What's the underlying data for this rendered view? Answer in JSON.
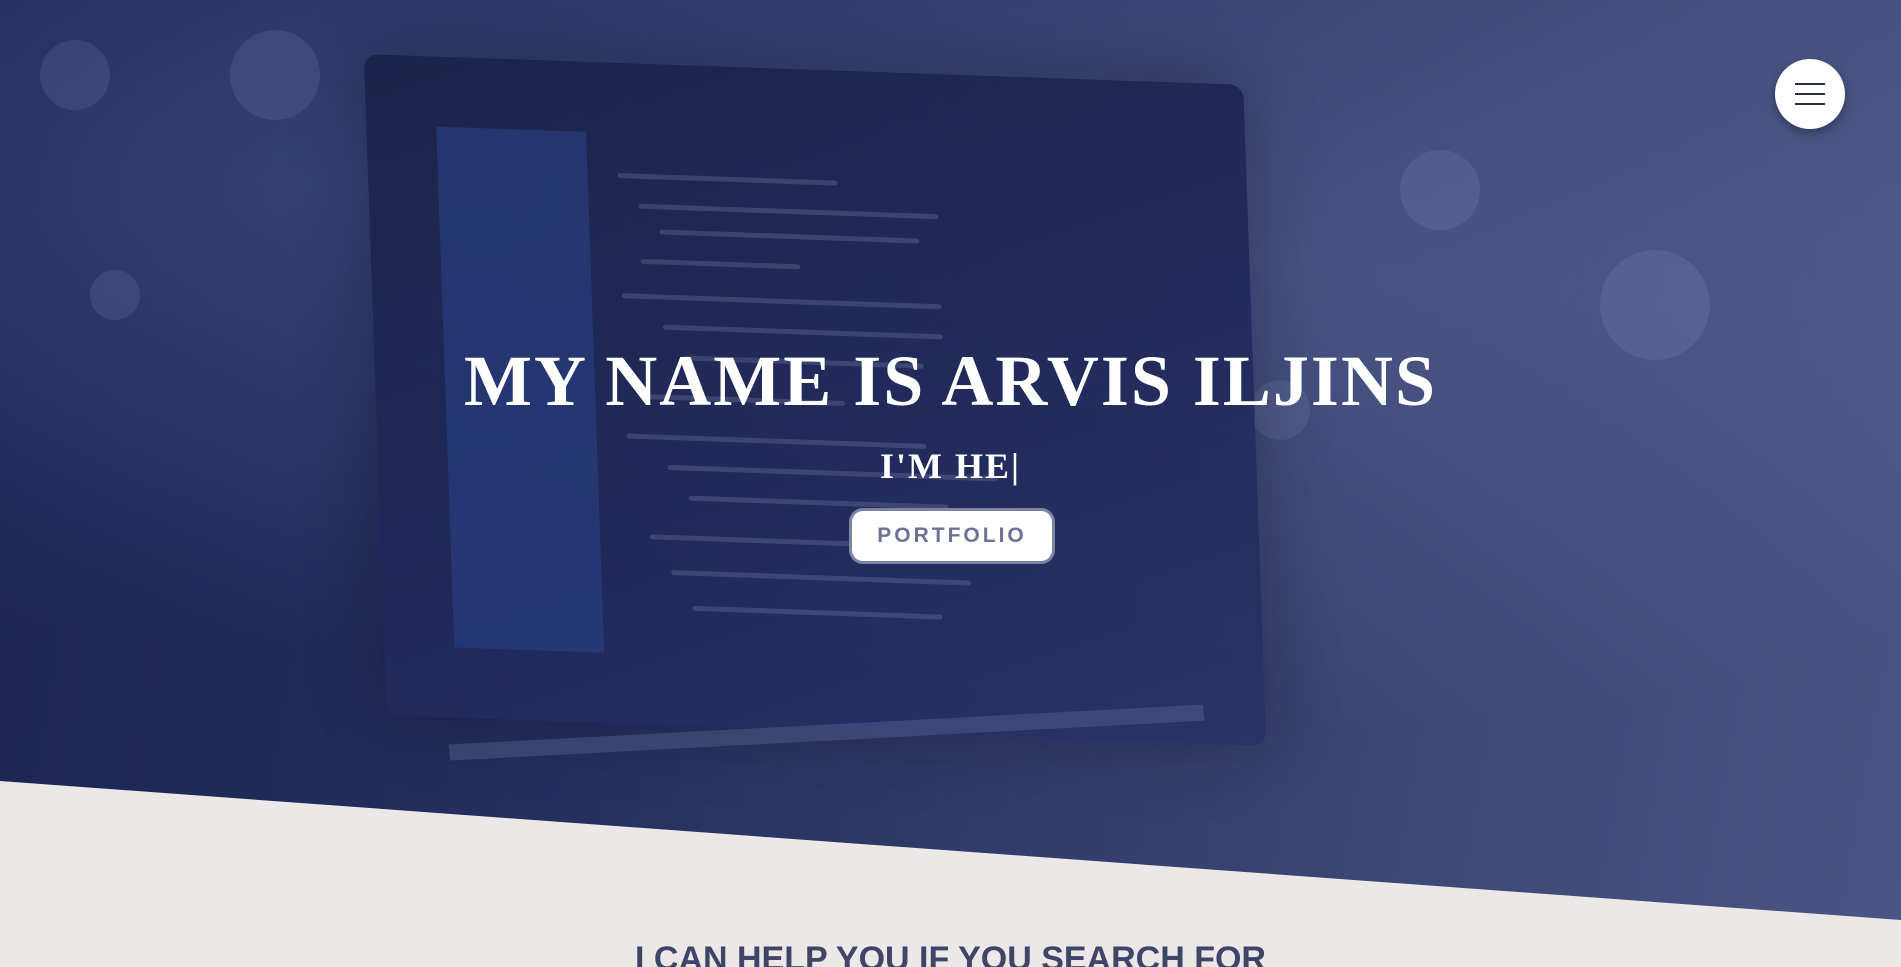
{
  "hero": {
    "title": "MY NAME IS ARVIS ILJINS",
    "subtitle": "I'M HE|",
    "cta_label": "PORTFOLIO"
  },
  "nav": {
    "menu_icon": "hamburger-menu-icon"
  },
  "services": {
    "heading": "I CAN HELP YOU IF YOU SEARCH FOR"
  },
  "colors": {
    "hero_dark": "#1b2452",
    "hero_light": "#4a5585",
    "page_bg": "#ece8e8",
    "heading_text": "#3f4568",
    "button_text": "#6c7396"
  }
}
